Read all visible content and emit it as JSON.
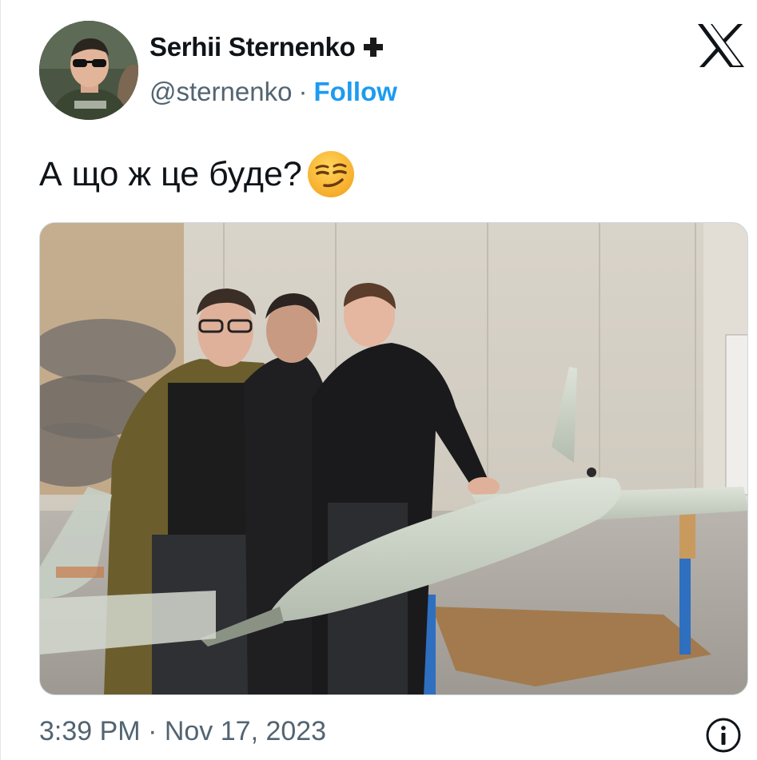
{
  "tweet": {
    "author": {
      "display_name": "Serhii Sternenko",
      "badge_icon": "plus-cross-icon",
      "handle": "@sternenko",
      "separator": "·",
      "follow_label": "Follow"
    },
    "platform_logo": "x-logo",
    "text": "А що ж це буде?",
    "emoji": "smirking-face-emoji",
    "media": {
      "type": "photo",
      "subject": "three-men-with-drone"
    },
    "timestamp": "3:39 PM · Nov 17, 2023",
    "info_icon": "info-icon"
  },
  "colors": {
    "text_primary": "#0f1419",
    "text_secondary": "#536471",
    "accent": "#1d9bf0"
  }
}
